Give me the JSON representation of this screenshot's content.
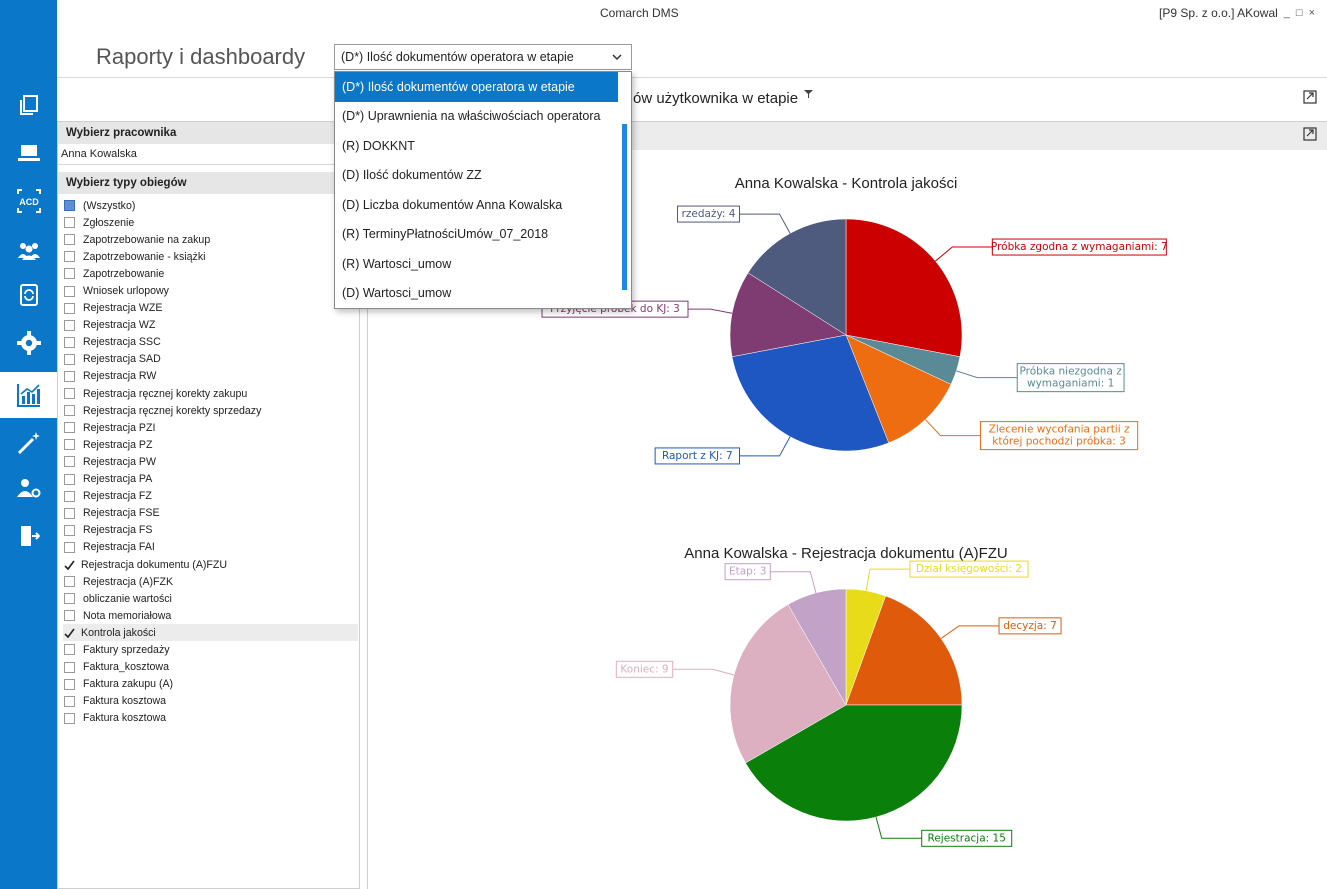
{
  "window": {
    "app_title": "Comarch DMS",
    "company_user": "[P9 Sp. z o.o.]  AKowal",
    "minimize": "_",
    "maximize": "□",
    "close": "×"
  },
  "page": {
    "heading": "Raporty i dashboardy"
  },
  "report_select": {
    "selected": "(D*) Ilość dokumentów operatora w etapie",
    "options": [
      "(D*) Ilość dokumentów operatora w etapie",
      "(D*) Uprawnienia na właściwościach operatora",
      "(R) DOKKNT",
      "(D) Ilość dokumentów ZZ",
      "(D) Liczba dokumentów Anna Kowalska",
      "(R) TerminyPłatnościUmów_07_2018",
      "(R) Wartosci_umow",
      "(D) Wartosci_umow"
    ]
  },
  "report_title": "ów użytkownika w etapie",
  "left_panel": {
    "employee_header": "Wybierz pracownika",
    "employee_value": "Anna Kowalska",
    "types_header": "Wybierz typy obiegów",
    "types": [
      {
        "label": "(Wszystko)",
        "state": "partial"
      },
      {
        "label": "Zgłoszenie",
        "state": "unchecked"
      },
      {
        "label": "Zapotrzebowanie na zakup",
        "state": "unchecked"
      },
      {
        "label": "Zapotrzebowanie - książki",
        "state": "unchecked"
      },
      {
        "label": "Zapotrzebowanie",
        "state": "unchecked"
      },
      {
        "label": "Wniosek urlopowy",
        "state": "unchecked"
      },
      {
        "label": "Rejestracja WZE",
        "state": "unchecked"
      },
      {
        "label": "Rejestracja WZ",
        "state": "unchecked"
      },
      {
        "label": "Rejestracja SSC",
        "state": "unchecked"
      },
      {
        "label": "Rejestracja SAD",
        "state": "unchecked"
      },
      {
        "label": "Rejestracja RW",
        "state": "unchecked"
      },
      {
        "label": "Rejestracja ręcznej korekty zakupu",
        "state": "unchecked"
      },
      {
        "label": "Rejestracja ręcznej korekty sprzedazy",
        "state": "unchecked"
      },
      {
        "label": "Rejestracja PZI",
        "state": "unchecked"
      },
      {
        "label": "Rejestracja PZ",
        "state": "unchecked"
      },
      {
        "label": "Rejestracja PW",
        "state": "unchecked"
      },
      {
        "label": "Rejestracja PA",
        "state": "unchecked"
      },
      {
        "label": "Rejestracja FZ",
        "state": "unchecked"
      },
      {
        "label": "Rejestracja FSE",
        "state": "unchecked"
      },
      {
        "label": "Rejestracja FS",
        "state": "unchecked"
      },
      {
        "label": "Rejestracja FAI",
        "state": "unchecked"
      },
      {
        "label": "Rejestracja dokumentu (A)FZU",
        "state": "checked"
      },
      {
        "label": "Rejestracja (A)FZK",
        "state": "unchecked"
      },
      {
        "label": "obliczanie wartości",
        "state": "unchecked"
      },
      {
        "label": "Nota memoriałowa",
        "state": "unchecked"
      },
      {
        "label": "Kontrola jakości",
        "state": "checked",
        "highlighted": true
      },
      {
        "label": "Faktury sprzedaży",
        "state": "unchecked"
      },
      {
        "label": "Faktura_kosztowa",
        "state": "unchecked"
      },
      {
        "label": "Faktura zakupu (A)",
        "state": "unchecked"
      },
      {
        "label": "Faktura kosztowa",
        "state": "unchecked"
      },
      {
        "label": "Faktura  kosztowa",
        "state": "unchecked"
      }
    ]
  },
  "sidebar_icons": [
    "documents-icon",
    "computer-icon",
    "acd-icon",
    "users-icon",
    "document-sync-icon",
    "settings-icon",
    "reports-icon",
    "wand-icon",
    "user-settings-icon",
    "logout-icon"
  ],
  "colors": {
    "sidebar": "#0a77c9",
    "selection": "#0a77c9"
  },
  "chart_data": [
    {
      "type": "pie",
      "title": "Anna Kowalska - Kontrola jakości",
      "slices": [
        {
          "label": "Próbka zgodna z wymaganiami: 7",
          "name": "Próbka zgodna z wymaganiami",
          "value": 7,
          "color": "#cc0000"
        },
        {
          "label": "Próbka niezgodna z wymaganiami: 1",
          "name": "Próbka niezgodna z wymaganiami",
          "value": 1,
          "color": "#5a8a96"
        },
        {
          "label": "Zlecenie wycofania partii z której pochodzi próbka: 3",
          "name": "Zlecenie wycofania partii z której pochodzi próbka",
          "value": 3,
          "color": "#ee6d10"
        },
        {
          "label": "Raport z KJ: 7",
          "name": "Raport z KJ",
          "value": 7,
          "color": "#1f57c2"
        },
        {
          "label": "Przyjęcie próbek do KJ: 3",
          "name": "Przyjęcie próbek do KJ",
          "value": 3,
          "color": "#7e3c72"
        },
        {
          "label": "rzedaży: 4",
          "name": "rzedaży",
          "value": 4,
          "color": "#4e5a7e"
        }
      ]
    },
    {
      "type": "pie",
      "title": "Anna Kowalska - Rejestracja dokumentu (A)FZU",
      "slices": [
        {
          "label": "Dział księgowości: 2",
          "name": "Dział księgowości",
          "value": 2,
          "color": "#e8dc1a"
        },
        {
          "label": "decyzja: 7",
          "name": "decyzja",
          "value": 7,
          "color": "#e05a0c"
        },
        {
          "label": "Rejestracja: 15",
          "name": "Rejestracja",
          "value": 15,
          "color": "#0a7f0a"
        },
        {
          "label": "Koniec: 9",
          "name": "Koniec",
          "value": 9,
          "color": "#dcb0c0"
        },
        {
          "label": "Etap: 3",
          "name": "Etap",
          "value": 3,
          "color": "#c3a2c8"
        }
      ]
    }
  ]
}
